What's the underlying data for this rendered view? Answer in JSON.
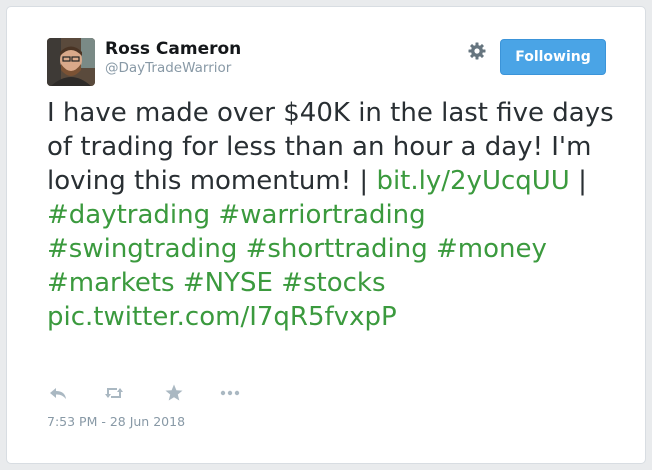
{
  "user": {
    "name": "Ross Cameron",
    "handle": "@DayTradeWarrior"
  },
  "follow_button": {
    "label": "Following"
  },
  "tweet": {
    "segments": [
      {
        "text": "I have made over $40K in the last five days of trading for less than an hour a day! I'm loving this momentum! | ",
        "type": "text"
      },
      {
        "text": "bit.ly/2yUcqUU",
        "type": "link"
      },
      {
        "text": " | ",
        "type": "text"
      },
      {
        "text": "#daytrading",
        "type": "hashtag"
      },
      {
        "text": " ",
        "type": "text"
      },
      {
        "text": "#warriortrading",
        "type": "hashtag"
      },
      {
        "text": " ",
        "type": "text"
      },
      {
        "text": "#swingtrading",
        "type": "hashtag"
      },
      {
        "text": " ",
        "type": "text"
      },
      {
        "text": "#shorttrading",
        "type": "hashtag"
      },
      {
        "text": " ",
        "type": "text"
      },
      {
        "text": "#money",
        "type": "hashtag"
      },
      {
        "text": " ",
        "type": "text"
      },
      {
        "text": "#markets",
        "type": "hashtag"
      },
      {
        "text": " ",
        "type": "text"
      },
      {
        "text": "#NYSE",
        "type": "hashtag"
      },
      {
        "text": " ",
        "type": "text"
      },
      {
        "text": "#stocks",
        "type": "hashtag"
      },
      {
        "text": " ",
        "type": "text"
      },
      {
        "text": "pic.twitter.com/I7qR5fvxpP",
        "type": "link"
      }
    ]
  },
  "actions": [
    {
      "icon": "reply-icon"
    },
    {
      "icon": "retweet-icon"
    },
    {
      "icon": "like-star-icon"
    },
    {
      "icon": "more-icon"
    }
  ],
  "timestamp": "7:53 PM - 28 Jun 2018",
  "colors": {
    "link": "#3b9a3e",
    "button": "#4aa4e6",
    "muted": "#8899a6",
    "text": "#292f33"
  }
}
